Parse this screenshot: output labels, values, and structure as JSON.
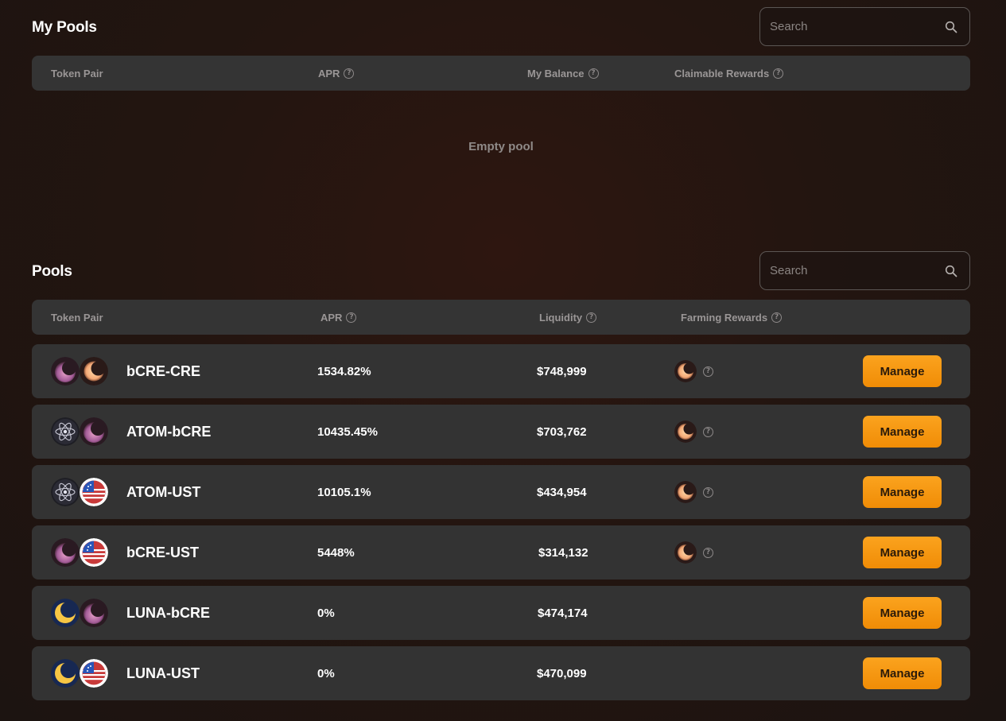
{
  "my_pools": {
    "title": "My Pools",
    "search_placeholder": "Search",
    "columns": {
      "token_pair": "Token Pair",
      "apr": "APR",
      "my_balance": "My Balance",
      "claimable_rewards": "Claimable Rewards"
    },
    "empty_text": "Empty pool"
  },
  "pools": {
    "title": "Pools",
    "search_placeholder": "Search",
    "columns": {
      "token_pair": "Token Pair",
      "apr": "APR",
      "liquidity": "Liquidity",
      "farming_rewards": "Farming Rewards"
    },
    "manage_label": "Manage",
    "rows": [
      {
        "pair": "bCRE-CRE",
        "apr": "1534.82%",
        "liquidity": "$748,999",
        "icons": [
          "bcre-token-icon",
          "cre-token-icon"
        ],
        "has_reward": true
      },
      {
        "pair": "ATOM-bCRE",
        "apr": "10435.45%",
        "liquidity": "$703,762",
        "icons": [
          "atom-token-icon",
          "bcre-token-icon"
        ],
        "has_reward": true
      },
      {
        "pair": "ATOM-UST",
        "apr": "10105.1%",
        "liquidity": "$434,954",
        "icons": [
          "atom-token-icon",
          "ust-token-icon"
        ],
        "has_reward": true
      },
      {
        "pair": "bCRE-UST",
        "apr": "5448%",
        "liquidity": "$314,132",
        "icons": [
          "bcre-token-icon",
          "ust-token-icon"
        ],
        "has_reward": true
      },
      {
        "pair": "LUNA-bCRE",
        "apr": "0%",
        "liquidity": "$474,174",
        "icons": [
          "luna-token-icon",
          "bcre-token-icon"
        ],
        "has_reward": false
      },
      {
        "pair": "LUNA-UST",
        "apr": "0%",
        "liquidity": "$470,099",
        "icons": [
          "luna-token-icon",
          "ust-token-icon"
        ],
        "has_reward": false
      }
    ]
  },
  "colors": {
    "accent": "#f5970f",
    "row_bg": "#333333",
    "header_bg": "#343434",
    "muted_text": "#9a9696"
  }
}
